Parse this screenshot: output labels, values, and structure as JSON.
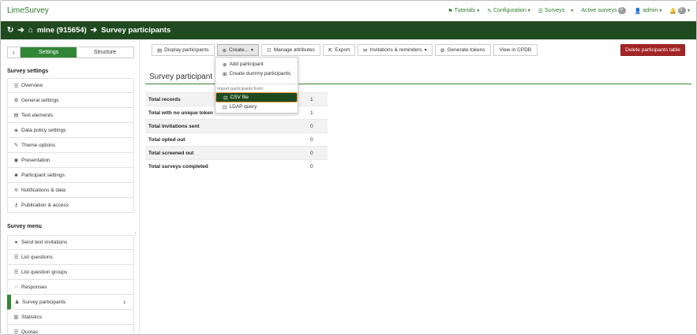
{
  "app": {
    "brand": "LimeSurvey"
  },
  "topnav": {
    "tutorials": "Tutorials",
    "configuration": "Configuration",
    "surveys": "Surveys",
    "active_surveys": "Active surveys",
    "active_surveys_count": "0",
    "admin": "admin",
    "notifications_count": "0"
  },
  "breadcrumb": {
    "survey": "mine (915654)",
    "page": "Survey participants"
  },
  "sidebar": {
    "tab_settings": "Settings",
    "tab_structure": "Structure",
    "settings_heading": "Survey settings",
    "settings_items": [
      {
        "label": "Overview",
        "icon": "list-icon"
      },
      {
        "label": "General settings",
        "icon": "gears-icon"
      },
      {
        "label": "Text elements",
        "icon": "file-text-icon"
      },
      {
        "label": "Data policy settings",
        "icon": "shield-icon"
      },
      {
        "label": "Theme options",
        "icon": "brush-icon"
      },
      {
        "label": "Presentation",
        "icon": "eye-icon"
      },
      {
        "label": "Participant settings",
        "icon": "users-icon"
      },
      {
        "label": "Notifications & data",
        "icon": "feed-icon"
      },
      {
        "label": "Publication & access",
        "icon": "key-icon"
      }
    ],
    "menu_heading": "Survey menu",
    "menu_items": [
      {
        "label": "Send text invitations",
        "icon": "comment-icon"
      },
      {
        "label": "List questions",
        "icon": "list-icon"
      },
      {
        "label": "List question groups",
        "icon": "list-icon"
      },
      {
        "label": "Responses",
        "icon": "comment-outline-icon"
      },
      {
        "label": "Survey participants",
        "icon": "user-icon"
      },
      {
        "label": "Statistics",
        "icon": "bar-chart-icon"
      },
      {
        "label": "Quotas",
        "icon": "tasks-icon"
      }
    ]
  },
  "toolbar": {
    "display_participants": "Display participants",
    "create": "Create...",
    "manage_attributes": "Manage attributes",
    "export": "Export",
    "invitations": "Invitations & reminders",
    "generate_tokens": "Generate tokens",
    "view_cpdb": "View in CPDB",
    "delete_table": "Delete participants table"
  },
  "dropdown": {
    "add_participant": "Add participant",
    "create_dummy": "Create dummy participants",
    "import_header": "Import participants from:",
    "csv_file": "CSV file",
    "ldap_query": "LDAP query"
  },
  "main": {
    "title": "Survey participant s",
    "stats": [
      {
        "label": "Total records",
        "value": "1"
      },
      {
        "label": "Total with no unique token",
        "value": "1"
      },
      {
        "label": "Total invitations sent",
        "value": "0"
      },
      {
        "label": "Total opted out",
        "value": "0"
      },
      {
        "label": "Total screened out",
        "value": "0"
      },
      {
        "label": "Total surveys completed",
        "value": "0"
      }
    ]
  },
  "colors": {
    "brand_green": "#328637",
    "dark_green": "#1f4a1f",
    "danger": "#a32525",
    "highlight_outline": "#f29a3b"
  }
}
